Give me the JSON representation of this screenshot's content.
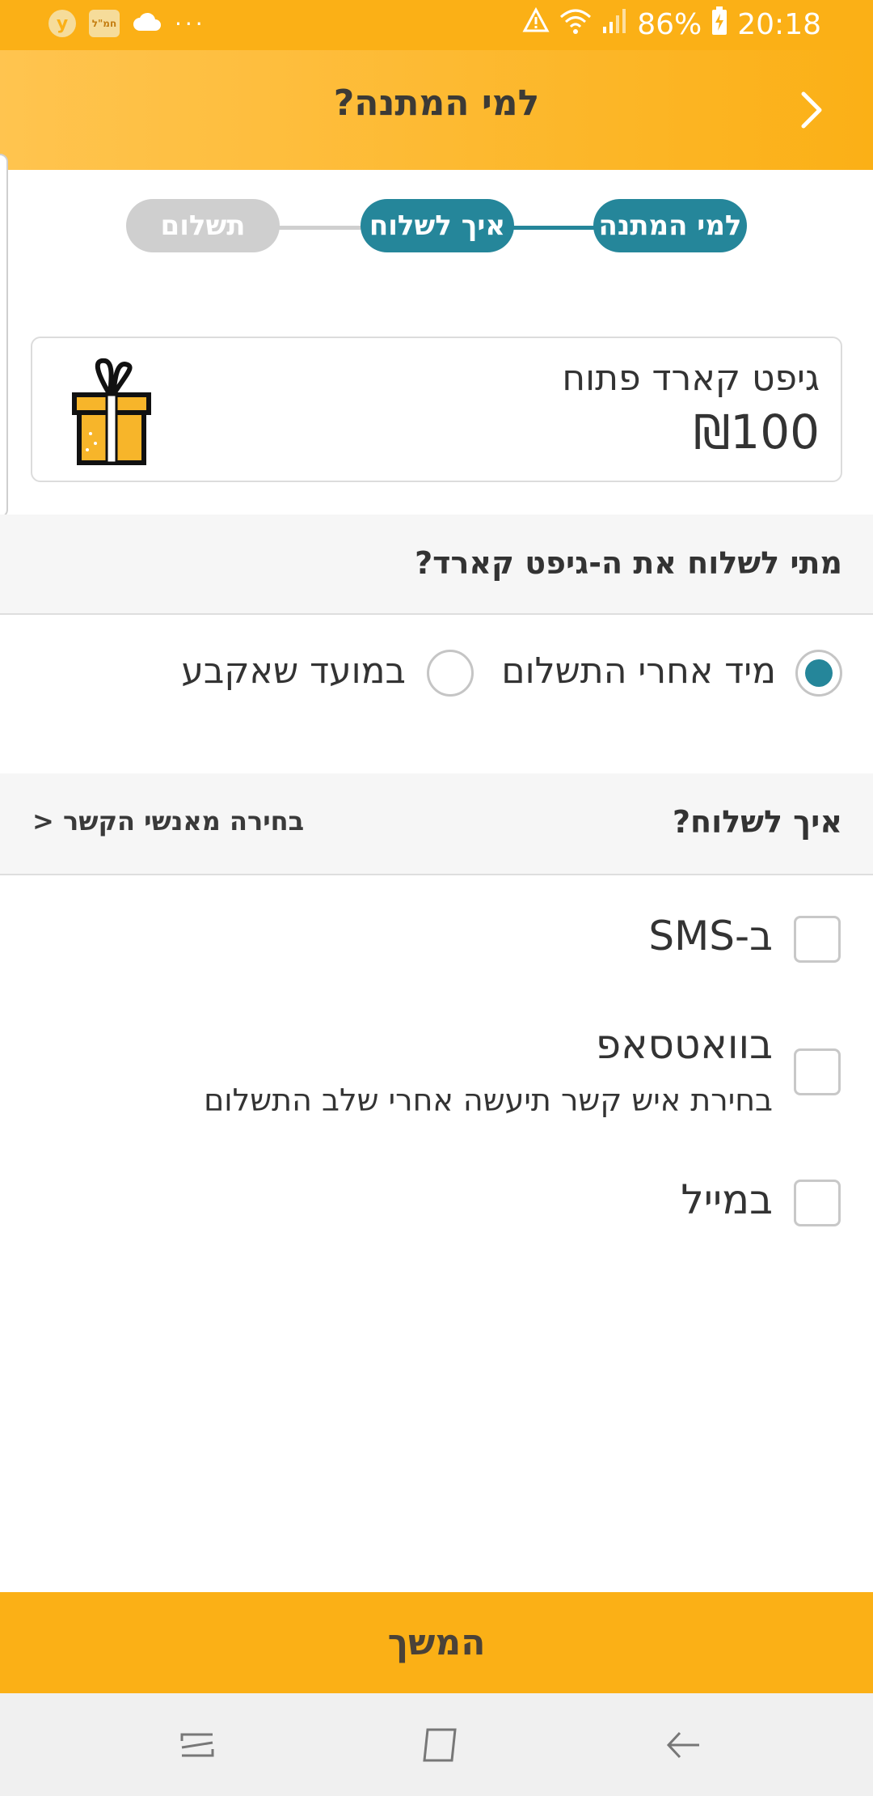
{
  "status_bar": {
    "left_badge_y": "y",
    "left_badge_hat": "חמ\"ל",
    "more_dots": "···",
    "battery": "86%",
    "time": "20:18"
  },
  "header": {
    "title": "למי המתנה?",
    "back_icon": "chevron-right-icon"
  },
  "stepper": {
    "steps": [
      {
        "label": "למי המתנה",
        "state": "done"
      },
      {
        "label": "איך לשלוח",
        "state": "active"
      },
      {
        "label": "תשלום",
        "state": "pending"
      }
    ],
    "colors": {
      "active": "#25869a",
      "inactive": "#cfcfcf"
    }
  },
  "gift_card": {
    "title": "גיפט קארד פתוח",
    "price": "₪100",
    "icon": "gift-box-icon"
  },
  "when_section": {
    "title": "מתי לשלוח את ה-גיפט קארד?",
    "options": [
      {
        "label": "מיד אחרי התשלום",
        "selected": true
      },
      {
        "label": "במועד שאקבע",
        "selected": false
      }
    ]
  },
  "how_section": {
    "title": "איך לשלוח?",
    "contacts_link": "בחירה מאנשי הקשר <",
    "methods": [
      {
        "label": "ב-SMS",
        "checked": false,
        "subtitle": ""
      },
      {
        "label": "בוואטסאפ",
        "checked": false,
        "subtitle": "בחירת איש קשר תיעשה אחרי שלב התשלום"
      },
      {
        "label": "במייל",
        "checked": false,
        "subtitle": ""
      }
    ]
  },
  "footer": {
    "continue_label": "המשך"
  },
  "colors": {
    "brand_yellow": "#fbb016",
    "accent_teal": "#25869a"
  }
}
